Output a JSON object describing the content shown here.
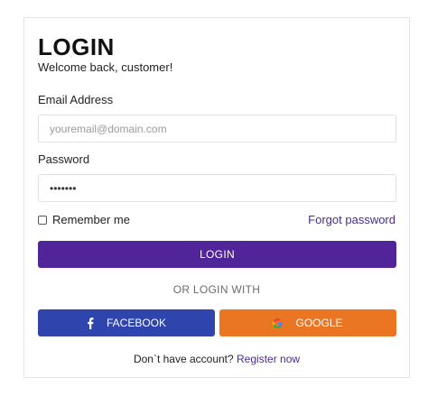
{
  "header": {
    "title": "LOGIN",
    "subtitle": "Welcome back, customer!"
  },
  "form": {
    "email_label": "Email Address",
    "email_placeholder": "youremail@domain.com",
    "password_label": "Password",
    "password_value": "•••••••",
    "remember_label": "Remember me",
    "remember_checked": false,
    "forgot_label": "Forgot password",
    "login_button": "LOGIN"
  },
  "social": {
    "divider_text": "OR LOGIN WITH",
    "facebook_label": "FACEBOOK",
    "google_label": "GOOGLE",
    "facebook_color": "#2f45ad",
    "google_color": "#ea7522"
  },
  "footer": {
    "prompt": "Don`t have account? ",
    "register_link": "Register now"
  },
  "colors": {
    "primary": "#52249a",
    "link": "#4b2a8f"
  }
}
